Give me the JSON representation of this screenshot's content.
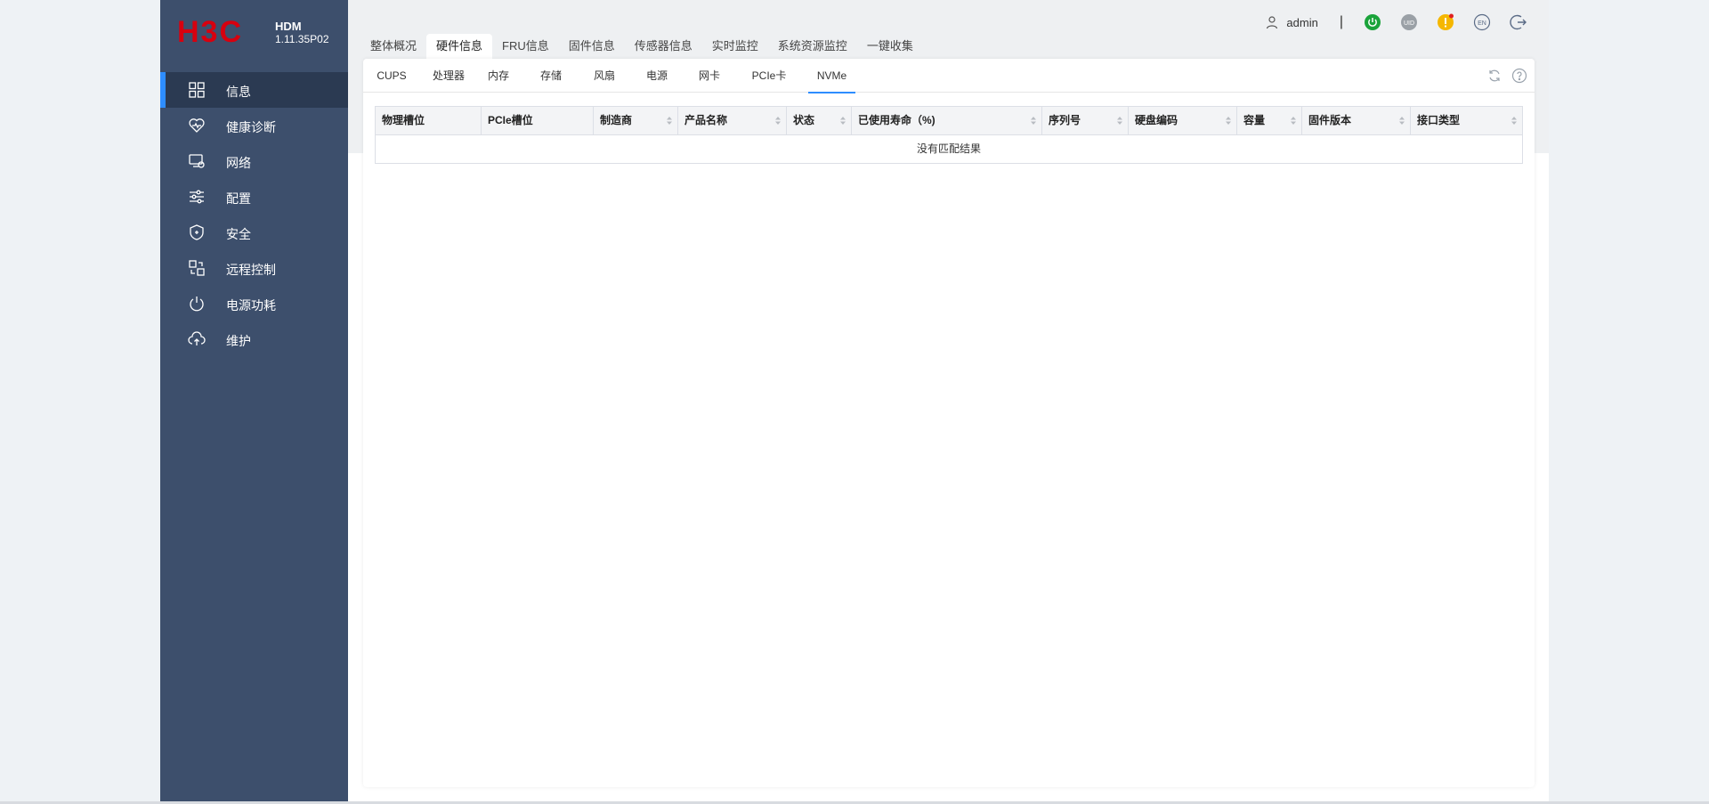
{
  "brand": {
    "logo_text": "H3C",
    "product": "HDM",
    "version": "1.11.35P02",
    "logo_color": "#d7000f"
  },
  "sidebar": {
    "items": [
      {
        "label": "信息",
        "icon": "grid-icon",
        "active": true
      },
      {
        "label": "健康诊断",
        "icon": "heart-icon",
        "active": false
      },
      {
        "label": "网络",
        "icon": "network-icon",
        "active": false
      },
      {
        "label": "配置",
        "icon": "sliders-icon",
        "active": false
      },
      {
        "label": "安全",
        "icon": "shield-icon",
        "active": false
      },
      {
        "label": "远程控制",
        "icon": "remote-icon",
        "active": false
      },
      {
        "label": "电源功耗",
        "icon": "power-icon",
        "active": false
      },
      {
        "label": "维护",
        "icon": "cloud-upload-icon",
        "active": false
      }
    ]
  },
  "header": {
    "username": "admin",
    "divider": "|",
    "uid_label": "UID",
    "lang_label": "EN",
    "power_color": "#1aa33a",
    "alert_color": "#f5b700"
  },
  "main_tabs": [
    {
      "label": "整体概况",
      "active": false
    },
    {
      "label": "硬件信息",
      "active": true
    },
    {
      "label": "FRU信息",
      "active": false
    },
    {
      "label": "固件信息",
      "active": false
    },
    {
      "label": "传感器信息",
      "active": false
    },
    {
      "label": "实时监控",
      "active": false
    },
    {
      "label": "系统资源监控",
      "active": false
    },
    {
      "label": "一键收集",
      "active": false
    }
  ],
  "sub_tabs": [
    {
      "label": "CUPS",
      "active": false
    },
    {
      "label": "处理器",
      "active": false
    },
    {
      "label": "内存",
      "active": false
    },
    {
      "label": "存储",
      "active": false
    },
    {
      "label": "风扇",
      "active": false
    },
    {
      "label": "电源",
      "active": false
    },
    {
      "label": "网卡",
      "active": false
    },
    {
      "label": "PCIe卡",
      "active": false
    },
    {
      "label": "NVMe",
      "active": true
    }
  ],
  "table": {
    "columns": [
      {
        "label": "物理槽位",
        "sortable": false
      },
      {
        "label": "PCIe槽位",
        "sortable": false
      },
      {
        "label": "制造商",
        "sortable": true
      },
      {
        "label": "产品名称",
        "sortable": true
      },
      {
        "label": "状态",
        "sortable": true
      },
      {
        "label": "已使用寿命（%)",
        "sortable": true
      },
      {
        "label": "序列号",
        "sortable": true
      },
      {
        "label": "硬盘编码",
        "sortable": true
      },
      {
        "label": "容量",
        "sortable": true
      },
      {
        "label": "固件版本",
        "sortable": true
      },
      {
        "label": "接口类型",
        "sortable": true
      }
    ],
    "empty_text": "没有匹配结果"
  },
  "accent_color": "#2e8dff",
  "sidebar_color": "#3d4f6c"
}
